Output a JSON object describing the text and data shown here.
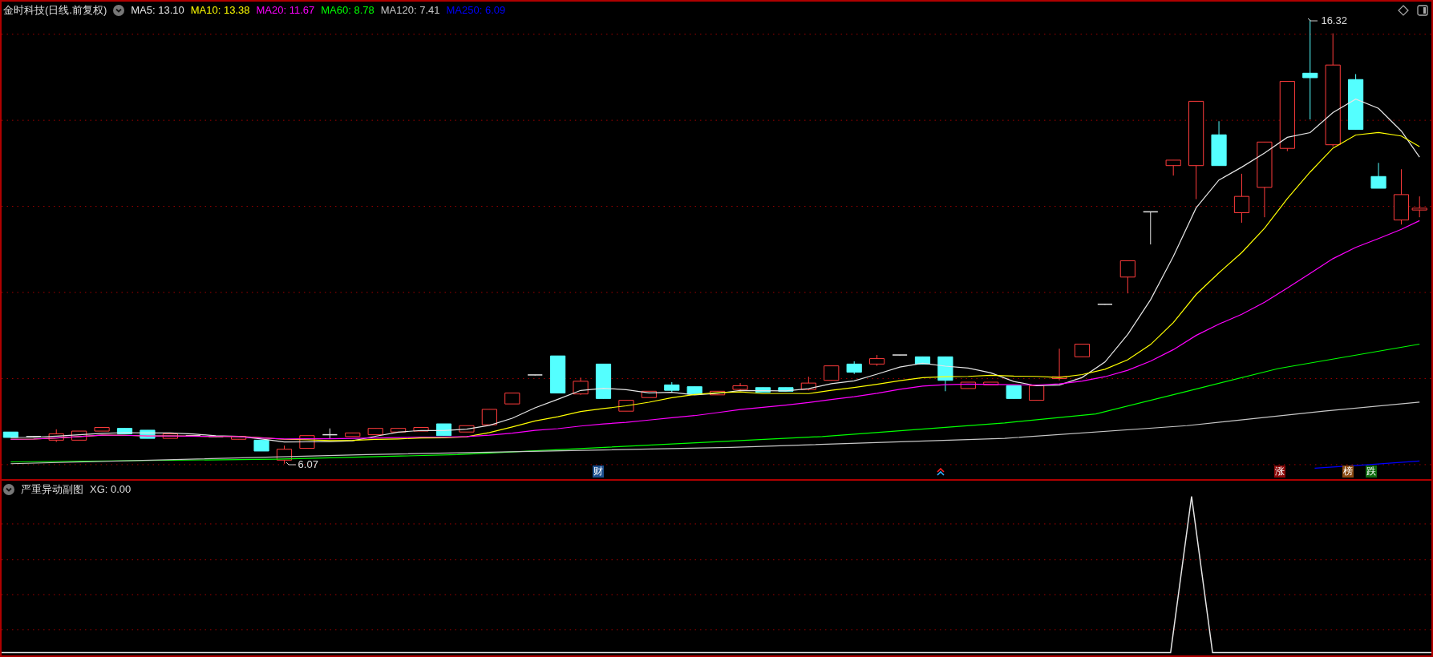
{
  "main_panel": {
    "title": "金时科技(日线.前复权)",
    "moving_averages": [
      {
        "label": "MA5: 13.10",
        "color": "#e6e6e6"
      },
      {
        "label": "MA10: 13.38",
        "color": "#ffff00"
      },
      {
        "label": "MA20: 11.67",
        "color": "#ff00ff"
      },
      {
        "label": "MA60: 8.78",
        "color": "#00ff00"
      },
      {
        "label": "MA120: 7.41",
        "color": "#c8c8c8"
      },
      {
        "label": "MA250: 6.09",
        "color": "#0000ff"
      }
    ],
    "high_label": "16.32",
    "low_label": "6.07",
    "flags": [
      {
        "label": "财",
        "color": "#1c4f8f"
      },
      {
        "label": "涨",
        "color": "#8b0a0a"
      },
      {
        "label": "榜",
        "color": "#8a4a12"
      },
      {
        "label": "跌",
        "color": "#0f6b0f"
      }
    ]
  },
  "sub_panel": {
    "title": "严重异动副图",
    "reading": "XG: 0.00"
  }
}
